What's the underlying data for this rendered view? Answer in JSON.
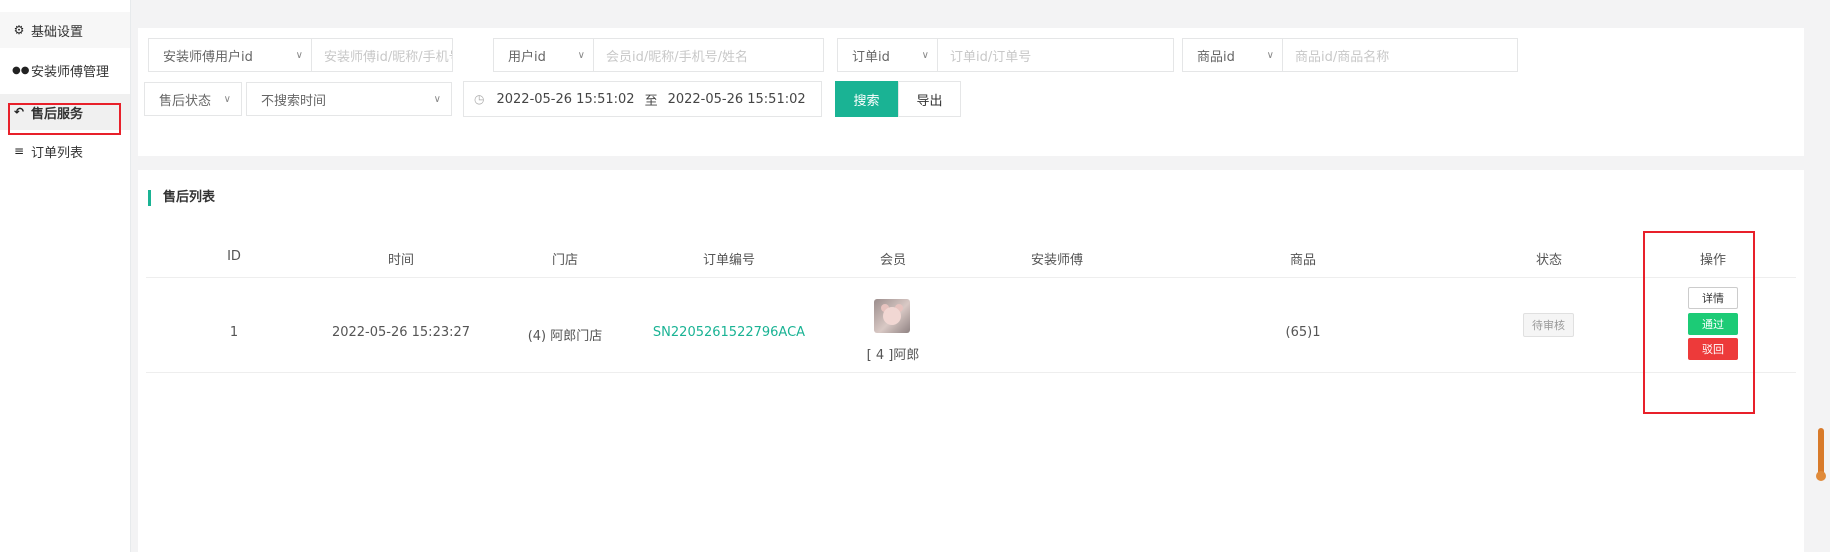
{
  "sidebar": {
    "items": [
      {
        "icon": "gear-icon",
        "glyph": "⚙",
        "label": "基础设置"
      },
      {
        "icon": "users-icon",
        "glyph": "👥",
        "label": "安装师傅管理"
      },
      {
        "icon": "reply-icon",
        "glyph": "↶",
        "label": "售后服务"
      },
      {
        "icon": "list-icon",
        "glyph": "≡",
        "label": "订单列表"
      }
    ]
  },
  "filters": {
    "installer": {
      "select": "安装师傅用户id",
      "placeholder": "安装师傅id/昵称/手机号/姓"
    },
    "user": {
      "select": "用户id",
      "placeholder": "会员id/昵称/手机号/姓名"
    },
    "order": {
      "select": "订单id",
      "placeholder": "订单id/订单号"
    },
    "product": {
      "select": "商品id",
      "placeholder": "商品id/商品名称"
    },
    "status_select": "售后状态",
    "time_select": "不搜索时间",
    "date_start": "2022-05-26 15:51:02",
    "date_sep": "至",
    "date_end": "2022-05-26 15:51:02",
    "search_label": "搜索",
    "export_label": "导出"
  },
  "list": {
    "title": "售后列表",
    "columns": [
      "ID",
      "时间",
      "门店",
      "订单编号",
      "会员",
      "安装师傅",
      "商品",
      "状态",
      "操作"
    ],
    "rows": [
      {
        "id": "1",
        "time": "2022-05-26 15:23:27",
        "store": "(4) 阿郎门店",
        "order_no": "SN2205261522796ACA",
        "member": "[ 4 ]阿郎",
        "installer": "",
        "product": "(65)1",
        "status": "待审核",
        "actions": {
          "detail": "详情",
          "pass": "通过",
          "reject": "驳回"
        }
      }
    ]
  },
  "colors": {
    "accent": "#1ab394",
    "pass": "#1ccb76",
    "reject": "#ed3a3a",
    "highlight_box": "#e8202a"
  }
}
